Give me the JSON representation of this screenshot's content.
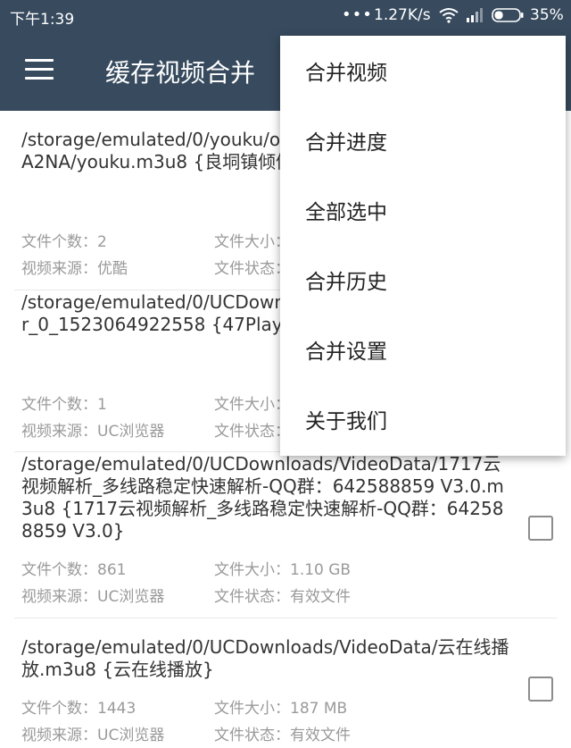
{
  "status_bar": {
    "time": "下午1:39",
    "more_dots": "•••",
    "speed": "1.27K/s",
    "battery_percent": "35%",
    "battery_level": 0.35
  },
  "toolbar": {
    "title": "缓存视频合并",
    "menu_icon": "hamburger-menu-icon"
  },
  "list": {
    "items": [
      {
        "path": "/storage/emulated/0/youku/offlinedata/XMzU2NDYzNDA2NA/youku.m3u8 {良垌镇倾倒入海 村民愤起阻拦}",
        "file_count": "文件个数：2",
        "file_size": "文件大小：",
        "source": "视频来源：优酷",
        "status": "文件状态："
      },
      {
        "path": "/storage/emulated/0/UCDownloads/VideoData/47Player_0_1523064922558 {47Player_0_1523064922558}",
        "file_count": "文件个数：1",
        "file_size": "文件大小：",
        "source": "视频来源：UC浏览器",
        "status": "文件状态："
      },
      {
        "path": "/storage/emulated/0/UCDownloads/VideoData/1717云视频解析_多线路稳定快速解析-QQ群：642588859 V3.0.m3u8 {1717云视频解析_多线路稳定快速解析-QQ群：642588859 V3.0}",
        "file_count": "文件个数：861",
        "file_size": "文件大小：1.10 GB",
        "source": "视频来源：UC浏览器",
        "status": "文件状态：有效文件"
      },
      {
        "path": "/storage/emulated/0/UCDownloads/VideoData/云在线播放.m3u8 {云在线播放}",
        "file_count": "文件个数：1443",
        "file_size": "文件大小：187 MB",
        "source": "视频来源：UC浏览器",
        "status": "文件状态：有效文件"
      }
    ]
  },
  "popup_menu": {
    "items": [
      "合并视频",
      "合并进度",
      "全部选中",
      "合并历史",
      "合并设置",
      "关于我们"
    ]
  },
  "colors": {
    "app_bar": "#374a5e",
    "text_primary": "#333333",
    "text_secondary": "#9a9a9a"
  }
}
